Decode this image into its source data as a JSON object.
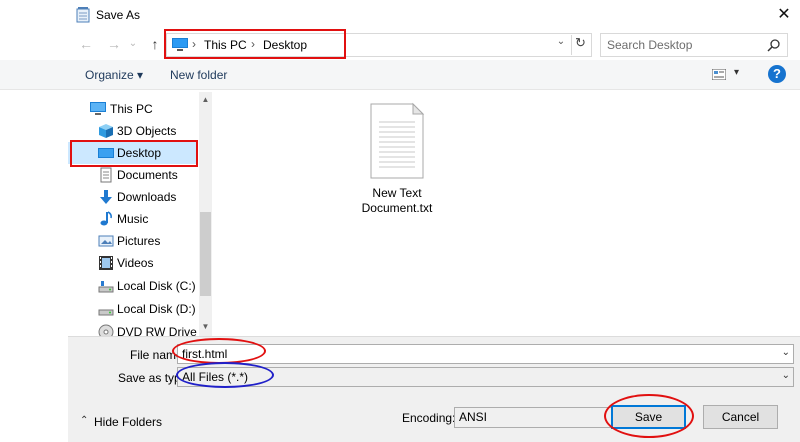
{
  "window": {
    "title": "Save As",
    "close_glyph": "✕"
  },
  "nav": {
    "back_glyph": "←",
    "forward_glyph": "→",
    "recent_glyph": "⌄",
    "up_glyph": "↑"
  },
  "address": {
    "sep1": "›",
    "crumb1": "This PC",
    "sep2": "›",
    "crumb2": "Desktop",
    "dropdown_glyph": "⌄",
    "refresh_glyph": "↻"
  },
  "search": {
    "placeholder": "Search Desktop"
  },
  "toolbar": {
    "organize_label": "Organize ▾",
    "new_folder_label": "New folder",
    "view_dropdown_glyph": "▾",
    "help_label": "?"
  },
  "sidebar": {
    "items": [
      {
        "label": "This PC",
        "icon": "computer-icon"
      },
      {
        "label": "3D Objects",
        "icon": "cube-icon"
      },
      {
        "label": "Desktop",
        "icon": "desktop-icon",
        "selected": true
      },
      {
        "label": "Documents",
        "icon": "document-icon"
      },
      {
        "label": "Downloads",
        "icon": "download-arrow-icon"
      },
      {
        "label": "Music",
        "icon": "music-note-icon"
      },
      {
        "label": "Pictures",
        "icon": "picture-icon"
      },
      {
        "label": "Videos",
        "icon": "film-icon"
      },
      {
        "label": "Local Disk (C:)",
        "icon": "drive-icon"
      },
      {
        "label": "Local Disk (D:)",
        "icon": "drive-icon"
      },
      {
        "label": "DVD RW Drive (E",
        "icon": "dvd-icon"
      }
    ],
    "scroll_up_glyph": "▲",
    "scroll_down_glyph": "▼"
  },
  "files": [
    {
      "name": "New Text Document.txt",
      "icon": "text-file-icon"
    }
  ],
  "form": {
    "file_name_label": "File name:",
    "file_name_value": "first.html",
    "save_type_label": "Save as type:",
    "save_type_value": "All Files  (*.*)",
    "encoding_label": "Encoding:",
    "encoding_value": "ANSI",
    "dropdown_glyph": "⌄"
  },
  "buttons": {
    "save": "Save",
    "cancel": "Cancel",
    "hide_folders": "Hide Folders",
    "hide_folders_glyph": "⌃"
  },
  "colors": {
    "annotation_red": "#e11010",
    "annotation_blue": "#2020c8",
    "selection": "#cce8ff",
    "accent": "#0078d7"
  }
}
